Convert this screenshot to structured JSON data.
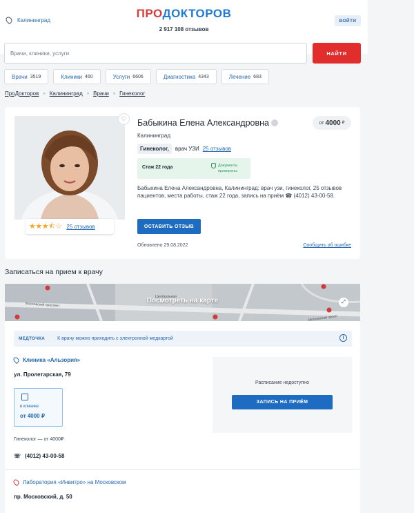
{
  "header": {
    "city": "Калининград",
    "logo_pro": "ПРО",
    "logo_rest": "ДОКТОРОВ",
    "reviews_count": "2 917 108 отзывов",
    "login_label": "ВОЙТИ"
  },
  "search": {
    "placeholder": "Врачи, клиники, услуги",
    "button_label": "НАЙТИ"
  },
  "categories": [
    {
      "label": "Врачи",
      "count": "3519"
    },
    {
      "label": "Клиники",
      "count": "460"
    },
    {
      "label": "Услуги",
      "count": "6606"
    },
    {
      "label": "Диагностика",
      "count": "4343"
    },
    {
      "label": "Лечение",
      "count": "683"
    }
  ],
  "breadcrumbs": [
    "ПроДокторов",
    "Калининград",
    "Врачи",
    "Гинеколог"
  ],
  "breadcrumb_sep": "»",
  "doctor": {
    "name": "Бабыкина Елена Александровна",
    "city": "Калининград",
    "price_prefix": "от",
    "price_value": "4000",
    "price_currency": "₽",
    "spec_main": "Гинеколог,",
    "spec_other": "врач УЗИ",
    "reviews_link": "25 отзывов",
    "rating": 3.5,
    "rating_stars": "★★★⯪☆",
    "experience": "Стаж 22 года",
    "docs_line1": "Документы",
    "docs_line2": "проверены",
    "description": "Бабыкина Елена Александровна, Калининград: врач узи, гинеколог, 25 отзывов пациентов, места работы, стаж 22 года, запись на приём ☎ (4012) 43-00-58.",
    "review_button": "ОСТАВИТЬ ОТЗЫВ",
    "updated": "Обновлено 29.08.2022",
    "report_link": "Сообщить об ошибке"
  },
  "appointment": {
    "section_title": "Записаться на прием к врачу",
    "map_button": "Посмотреть на карте",
    "map_street_1": "Московский проспект",
    "map_street_2": "Московский просп",
    "map_district": "Центральная",
    "med_logo_a": "МЕД",
    "med_logo_b": "ТОЧКА",
    "med_text": "К врачу можно приходить с электронной медкартой",
    "clinic_name": "Клиника «Альзория»",
    "clinic_address": "ул. Пролетарская, 79",
    "tile_label": "в клинике",
    "tile_price": "от 4000 ₽",
    "clinic_price_line": "Гинеколог — от 4000₽",
    "phone": "(4012) 43-00-58",
    "schedule_text": "Расписание недоступно",
    "book_button": "ЗАПИСЬ НА ПРИЁМ",
    "lab_name": "Лаборатория «Инвитро» на Московском",
    "lab_address": "пр. Московский, д. 50"
  }
}
